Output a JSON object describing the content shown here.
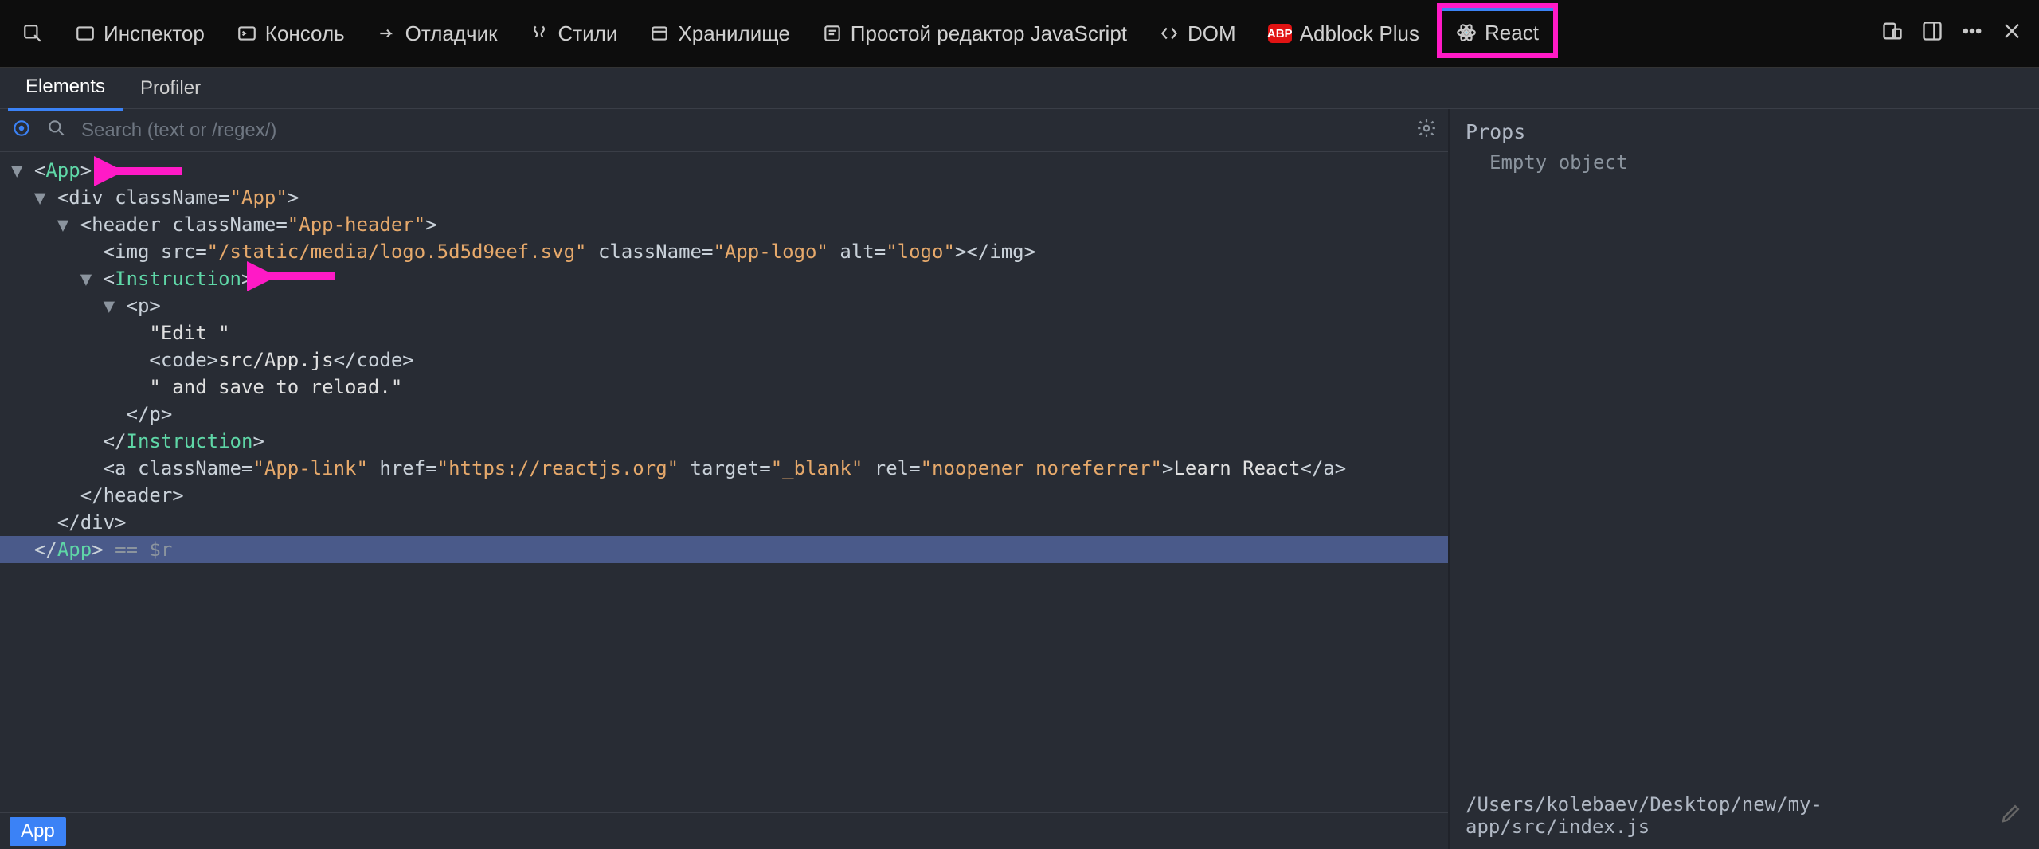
{
  "devtools_tabs": {
    "inspector": "Инспектор",
    "console": "Консоль",
    "debugger": "Отладчик",
    "styles": "Стили",
    "storage": "Хранилище",
    "jseditor": "Простой редактор JavaScript",
    "dom": "DOM",
    "adblock": "Adblock Plus",
    "react": "React",
    "abp_badge": "ABP"
  },
  "react_subtabs": {
    "elements": "Elements",
    "profiler": "Profiler"
  },
  "search": {
    "placeholder": "Search (text or /regex/)"
  },
  "tree": {
    "l1_open": "<",
    "l1_name": "App",
    "l1_close": ">",
    "l2": "<div className=\"App\">",
    "l3": "<header className=\"App-header\">",
    "l4": "<img src=\"/static/media/logo.5d5d9eef.svg\" className=\"App-logo\" alt=\"logo\"></img>",
    "l5_open": "<",
    "l5_name": "Instruction",
    "l5_close": ">",
    "l6": "<p>",
    "l7": "\"Edit \"",
    "l8": "<code>src/App.js</code>",
    "l9": "\" and save to reload.\"",
    "l10": "</p>",
    "l11_open": "</",
    "l11_name": "Instruction",
    "l11_close": ">",
    "l12": "<a className=\"App-link\" href=\"https://reactjs.org\" target=\"_blank\" rel=\"noopener noreferrer\">Learn React</a>",
    "l13": "</header>",
    "l14": "</div>",
    "l15_open": "</",
    "l15_name": "App",
    "l15_close": ">",
    "l15_after": " == $r"
  },
  "breadcrumb": {
    "app": "App"
  },
  "side": {
    "props_heading": "Props",
    "props_value": "Empty object",
    "source_path": "/Users/kolebaev/Desktop/new/my-app/src/index.js"
  }
}
